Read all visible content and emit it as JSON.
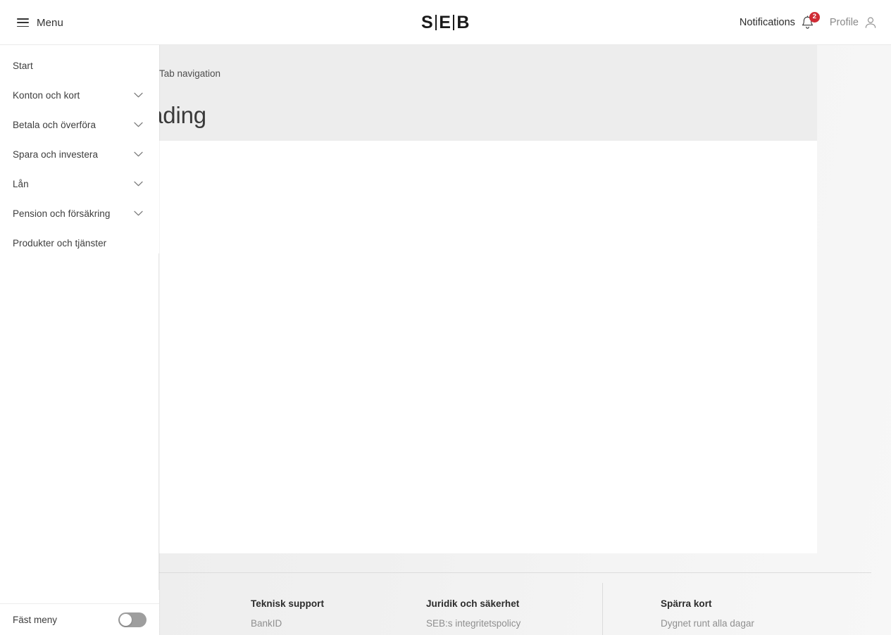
{
  "header": {
    "menu_label": "Menu",
    "menu_icon": "hamburger-icon",
    "brand": {
      "part1": "S",
      "part2": "E",
      "part3": "B"
    },
    "notifications": {
      "label": "Notifications",
      "icon": "bell-icon",
      "badge_count": "2",
      "badge_color": "#cf2c35"
    },
    "profile": {
      "label": "Profile",
      "icon": "user-icon"
    }
  },
  "sidebar": {
    "items": [
      {
        "label": "Start",
        "expandable": false
      },
      {
        "label": "Konton och kort",
        "expandable": true
      },
      {
        "label": "Betala och överföra",
        "expandable": true
      },
      {
        "label": "Spara och investera",
        "expandable": true
      },
      {
        "label": "Lån",
        "expandable": true
      },
      {
        "label": "Pension och försäkring",
        "expandable": true
      },
      {
        "label": "Produkter och tjänster",
        "expandable": false
      }
    ],
    "pin": {
      "label": "Fäst meny",
      "toggle_state": "off"
    }
  },
  "content": {
    "tab_navigation": "Tab navigation",
    "heading": "eading"
  },
  "footer": {
    "columns": [
      {
        "title": "Teknisk support",
        "links": [
          "BankID"
        ]
      },
      {
        "title": "Juridik och säkerhet",
        "links": [
          "SEB:s integritetspolicy"
        ]
      },
      {
        "title": "Spärra kort",
        "links": [
          "Dygnet runt alla dagar"
        ]
      }
    ]
  },
  "colors": {
    "page_background": "#f1f1f1",
    "hero_band": "#ededed",
    "card": "#ffffff",
    "accent_red": "#cf2c35",
    "text_primary": "#333333",
    "text_muted": "#8f8f8f"
  }
}
